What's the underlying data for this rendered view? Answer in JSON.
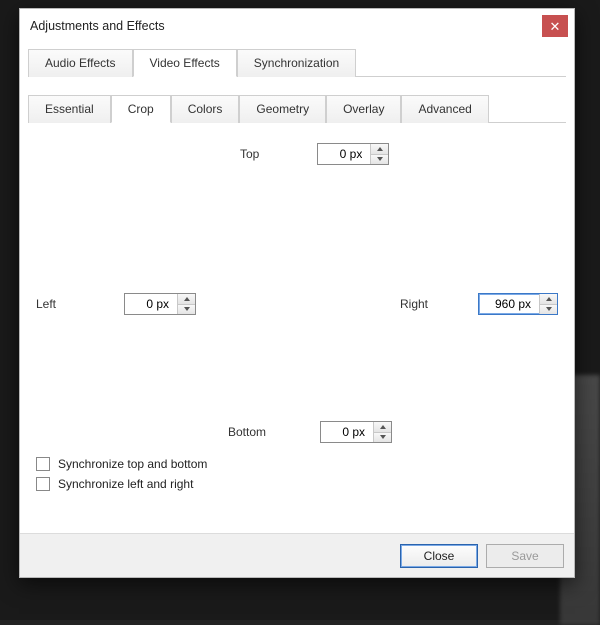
{
  "window": {
    "title": "Adjustments and Effects",
    "close_glyph": "✕"
  },
  "main_tabs": {
    "t0": "Audio Effects",
    "t1": "Video Effects",
    "t2": "Synchronization",
    "active_index": 1
  },
  "sub_tabs": {
    "t0": "Essential",
    "t1": "Crop",
    "t2": "Colors",
    "t3": "Geometry",
    "t4": "Overlay",
    "t5": "Advanced",
    "active_index": 1
  },
  "crop": {
    "top": {
      "label": "Top",
      "value": "0 px"
    },
    "left": {
      "label": "Left",
      "value": "0 px"
    },
    "right": {
      "label": "Right",
      "value": "960 px"
    },
    "bottom": {
      "label": "Bottom",
      "value": "0 px"
    }
  },
  "checkboxes": {
    "sync_tb": {
      "label": "Synchronize top and bottom",
      "checked": false
    },
    "sync_lr": {
      "label": "Synchronize left and right",
      "checked": false
    }
  },
  "actions": {
    "close": "Close",
    "save": "Save"
  }
}
